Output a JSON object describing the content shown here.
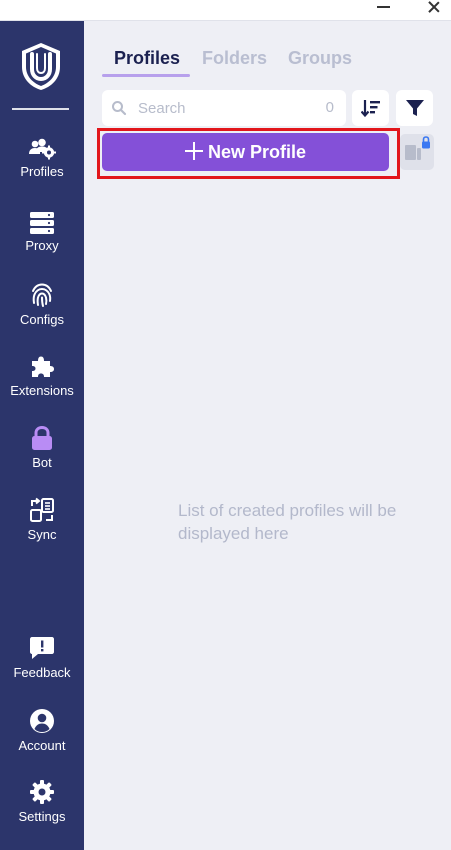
{
  "window": {
    "controls": [
      "minimize-icon",
      "close-icon"
    ]
  },
  "sidebar": {
    "logo": "fingerprint-shield-logo",
    "items": [
      {
        "id": "profiles",
        "label": "Profiles",
        "icon": "users-gear-icon"
      },
      {
        "id": "proxy",
        "label": "Proxy",
        "icon": "server-stack-icon"
      },
      {
        "id": "configs",
        "label": "Configs",
        "icon": "fingerprint-icon"
      },
      {
        "id": "extensions",
        "label": "Extensions",
        "icon": "puzzle-icon"
      },
      {
        "id": "bot",
        "label": "Bot",
        "icon": "lock-icon",
        "accent": "#b98cf5"
      },
      {
        "id": "sync",
        "label": "Sync",
        "icon": "sync-icon"
      },
      {
        "id": "feedback",
        "label": "Feedback",
        "icon": "feedback-icon"
      },
      {
        "id": "account",
        "label": "Account",
        "icon": "account-icon"
      },
      {
        "id": "settings",
        "label": "Settings",
        "icon": "gear-icon"
      }
    ]
  },
  "main": {
    "tabs": [
      {
        "label": "Profiles",
        "active": true
      },
      {
        "label": "Folders",
        "active": false
      },
      {
        "label": "Groups",
        "active": false
      }
    ],
    "search": {
      "placeholder": "Search",
      "value": "",
      "count": "0"
    },
    "toolbar": {
      "sort_icon": "sort-icon",
      "filter_icon": "filter-icon"
    },
    "new_profile_label": "New Profile",
    "empty_message": "List of created profiles will be displayed here"
  },
  "colors": {
    "sidebar": "#2c356b",
    "accent": "#8450d8",
    "background": "#eeeff5",
    "highlight": "#e2161b"
  }
}
